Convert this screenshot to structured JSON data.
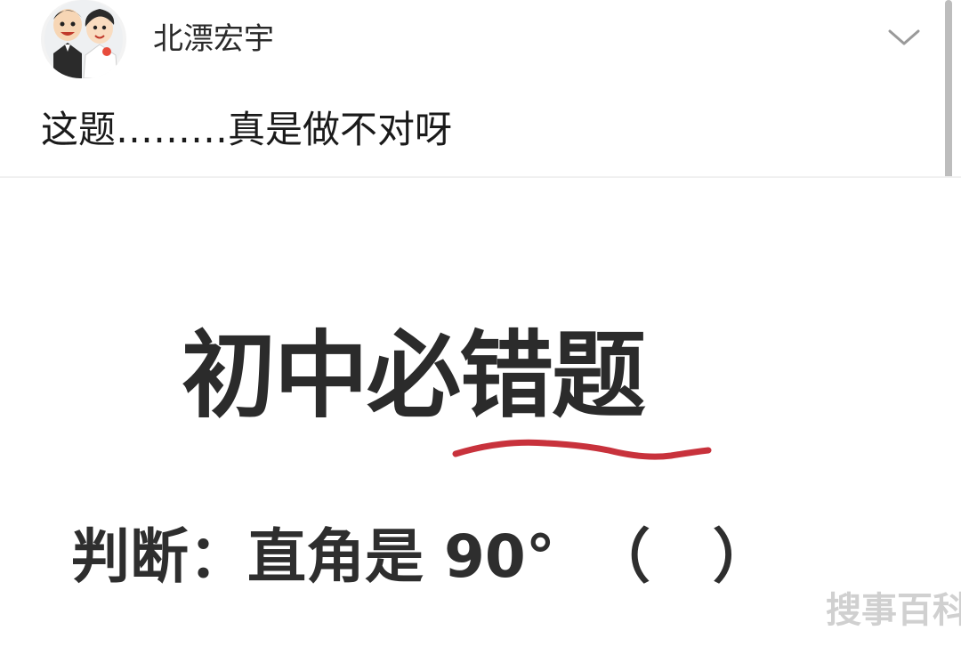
{
  "post": {
    "username": "北漂宏宇",
    "text": "这题………真是做不对呀"
  },
  "image": {
    "title": "初中必错题",
    "question": "判断：直角是 90°（ ）",
    "question_text": "判断：直角是 90°",
    "paren_open": "（",
    "paren_close": "）",
    "watermark": "搜事百科"
  },
  "icons": {
    "avatar": "cartoon-couple-avatar",
    "more": "chevron-down-icon"
  },
  "colors": {
    "underline": "#c8323c"
  }
}
